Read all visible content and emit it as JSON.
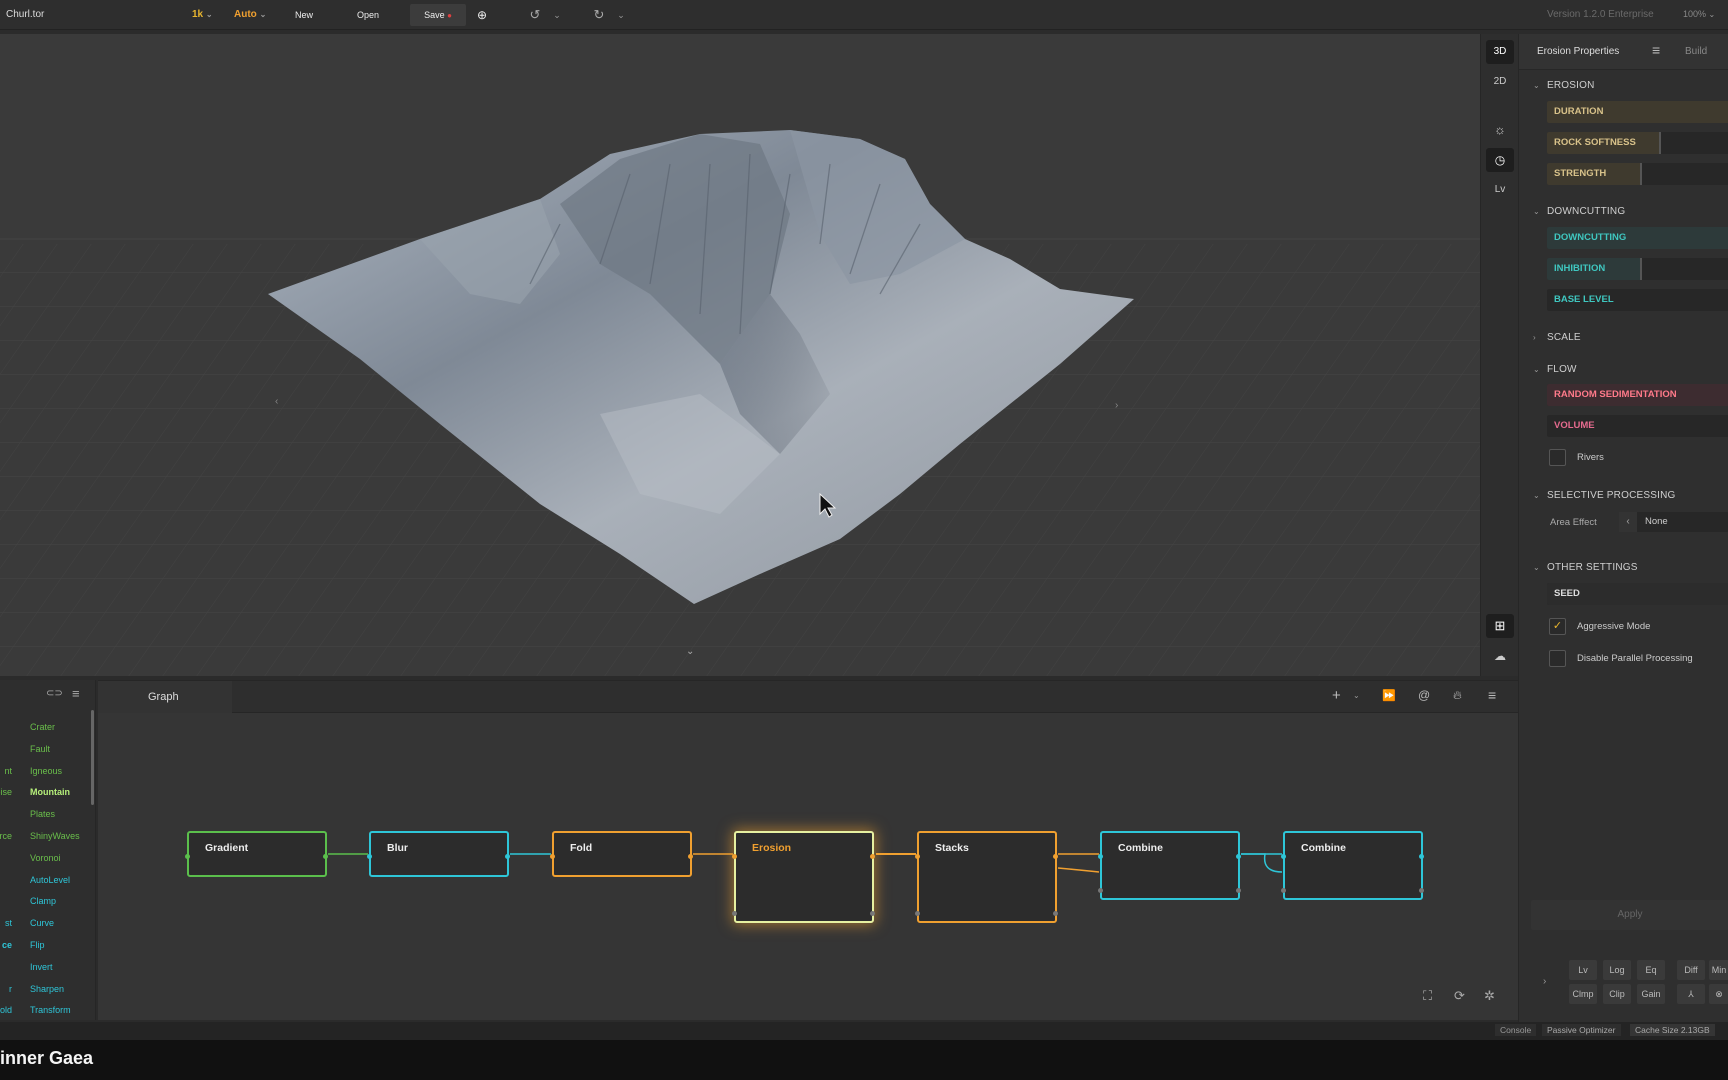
{
  "topbar": {
    "file": "Churl.tor",
    "resolution": "1k",
    "mode": "Auto",
    "new": "New",
    "open": "Open",
    "save": "Save",
    "version": "Version 1.2.0 Enterprise",
    "zoom": "100%"
  },
  "viewstrip": {
    "mode3d": "3D",
    "mode2d": "2D",
    "lv": "Lv"
  },
  "props": {
    "title": "Erosion Properties",
    "build_tab": "Build",
    "sections": {
      "erosion": "EROSION",
      "downcutting": "DOWNCUTTING",
      "scale": "SCALE",
      "flow": "FLOW",
      "selective": "SELECTIVE PROCESSING",
      "other": "OTHER SETTINGS"
    },
    "fields": {
      "duration": "DURATION",
      "rock_softness": "ROCK SOFTNESS",
      "strength": "STRENGTH",
      "downcutting": "DOWNCUTTING",
      "inhibition": "INHIBITION",
      "base_level": "BASE LEVEL",
      "random_sedimentation": "RANDOM SEDIMENTATION",
      "volume": "VOLUME",
      "seed": "SEED"
    },
    "rivers": "Rivers",
    "area_effect_label": "Area Effect",
    "area_effect_value": "None",
    "aggressive": "Aggressive Mode",
    "disable_parallel": "Disable Parallel Processing",
    "apply": "Apply",
    "tools_row1": [
      "Lv",
      "Log",
      "Eq",
      "Diff",
      "Min"
    ],
    "tools_row2": [
      "Clmp",
      "Clip",
      "Gain"
    ]
  },
  "graph": {
    "tab": "Graph",
    "nodes": [
      "Gradient",
      "Blur",
      "Fold",
      "Erosion",
      "Stacks",
      "Combine",
      "Combine"
    ]
  },
  "library": {
    "left_fragments": [
      "nt",
      "oise",
      "rce",
      "st",
      "ce",
      "r",
      "hold"
    ],
    "items": [
      "Crater",
      "Fault",
      "Igneous",
      "Mountain",
      "Plates",
      "ShinyWaves",
      "Voronoi",
      "AutoLevel",
      "Clamp",
      "Curve",
      "Flip",
      "Invert",
      "Sharpen",
      "Transform"
    ]
  },
  "status": {
    "console": "Console",
    "optimizer": "Passive Optimizer",
    "cache": "Cache Size 2.13GB"
  },
  "caption": "inner Gaea"
}
